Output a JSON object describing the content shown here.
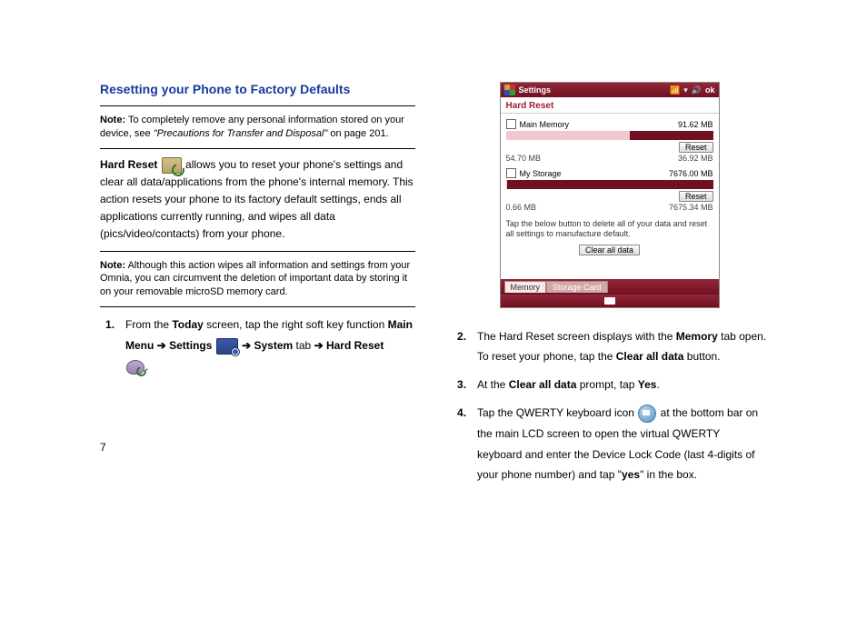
{
  "section_title": "Resetting your Phone to Factory Defaults",
  "note1": {
    "label": "Note:",
    "text_a": "To completely remove any personal information stored on your device, see ",
    "text_italic": "\"Precautions for Transfer and Disposal\"",
    "text_b": " on page 201."
  },
  "intro": {
    "hard_reset_label": "Hard Reset",
    "text": " allows you to reset your phone's settings and clear all data/applications from the phone's internal memory. This action resets your phone to its factory default settings, ends all applications currently running, and wipes all data (pics/video/contacts) from your phone."
  },
  "note2": {
    "label": "Note:",
    "text": "Although this action wipes all information and settings from your Omnia, you can circumvent the deletion of important data by storing it on your removable microSD memory card."
  },
  "step1": {
    "a": "From the ",
    "today": "Today",
    "b": " screen, tap the right soft key function ",
    "main_menu": "Main Menu",
    "arrow": "  ➔ ",
    "settings": "Settings",
    "system": "System",
    "tab_word": " tab ",
    "hard_reset": "Hard Reset",
    "period": "."
  },
  "step2": {
    "a": "The Hard Reset screen displays with the ",
    "memory": "Memory",
    "b": " tab open. To reset your phone, tap the ",
    "clear_all": "Clear all data",
    "c": " button."
  },
  "step3": {
    "a": "At the ",
    "clear_all": "Clear all data",
    "b": " prompt, tap ",
    "yes": "Yes",
    "c": "."
  },
  "step4": {
    "a": "Tap the QWERTY keyboard icon ",
    "b": " at the bottom bar on the main LCD screen to open the virtual QWERTY keyboard and enter the Device Lock Code (last 4-digits of your phone number) and tap \"",
    "yes": "yes",
    "c": "\" in the box."
  },
  "phone": {
    "titlebar": "Settings",
    "ok": "ok",
    "header": "Hard Reset",
    "main_memory_label": "Main Memory",
    "main_memory_value": "91.62 MB",
    "reset_btn": "Reset",
    "scale1_left": "54.70 MB",
    "scale1_right": "36.92 MB",
    "fill1_pct": "60%",
    "my_storage_label": "My Storage",
    "my_storage_value": "7676.00 MB",
    "scale2_left": "0.66 MB",
    "scale2_right": "7675.34 MB",
    "fill2_pct": "0.5%",
    "note": "Tap the below button to delete all of your data and reset all settings to manufacture default.",
    "clear_btn": "Clear all data",
    "tab_memory": "Memory",
    "tab_storage": "Storage Card"
  },
  "page_number": "7"
}
